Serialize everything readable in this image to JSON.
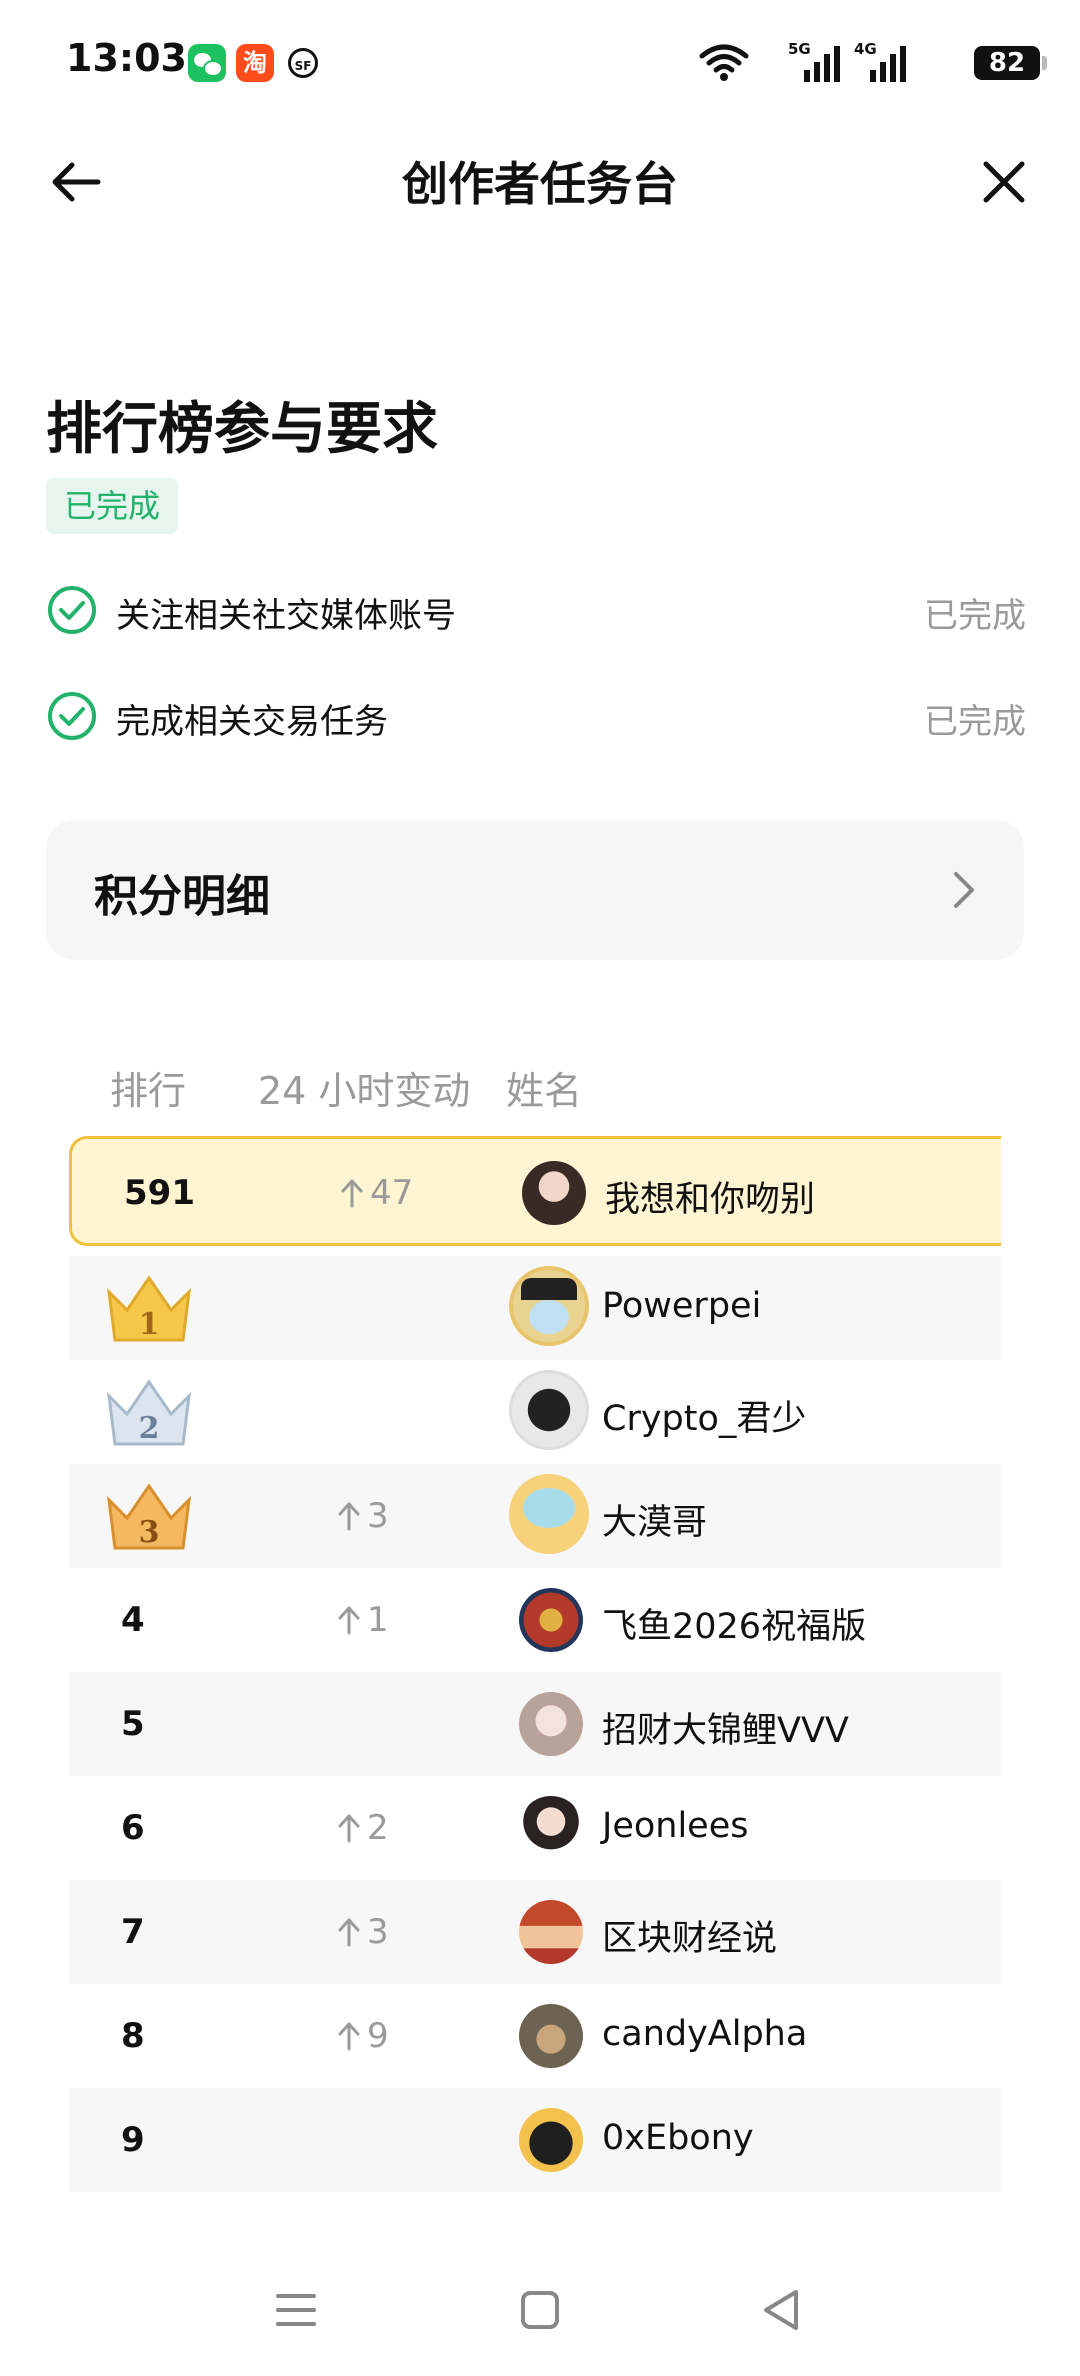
{
  "status_bar": {
    "time": "13:03",
    "apps": [
      "wechat-icon",
      "taobao-icon",
      "sf-icon"
    ],
    "taobao_glyph": "淘",
    "sf_glyph": "SF",
    "net1": "5G",
    "net2": "4G",
    "battery": "82"
  },
  "header": {
    "title": "创作者任务台"
  },
  "requirements": {
    "title": "排行榜参与要求",
    "badge": "已完成",
    "items": [
      {
        "label": "关注相关社交媒体账号",
        "status": "已完成"
      },
      {
        "label": "完成相关交易任务",
        "status": "已完成"
      }
    ]
  },
  "points": {
    "label": "积分明细"
  },
  "leaderboard": {
    "columns": [
      "排行",
      "24 小时变动",
      "姓名"
    ],
    "my_row": {
      "rank": "591",
      "change": "47",
      "name": "我想和你吻别"
    },
    "rows": [
      {
        "rank": "1",
        "change": "",
        "name": "Powerpei"
      },
      {
        "rank": "2",
        "change": "",
        "name": "Crypto_君少"
      },
      {
        "rank": "3",
        "change": "3",
        "name": "大漠哥"
      },
      {
        "rank": "4",
        "change": "1",
        "name": "飞鱼2026祝福版"
      },
      {
        "rank": "5",
        "change": "",
        "name": "招财大锦鲤VVV"
      },
      {
        "rank": "6",
        "change": "2",
        "name": "Jeonlees"
      },
      {
        "rank": "7",
        "change": "3",
        "name": "区块财经说"
      },
      {
        "rank": "8",
        "change": "9",
        "name": "candyAlpha"
      },
      {
        "rank": "9",
        "change": "",
        "name": "0xEbony"
      }
    ]
  },
  "colors": {
    "accent_green": "#22b26b",
    "highlight_border": "#f0c23b",
    "highlight_bg": "#fff5d2",
    "gold": "#f5c84a",
    "silver": "#c9d6e6",
    "bronze": "#f0a94a"
  }
}
